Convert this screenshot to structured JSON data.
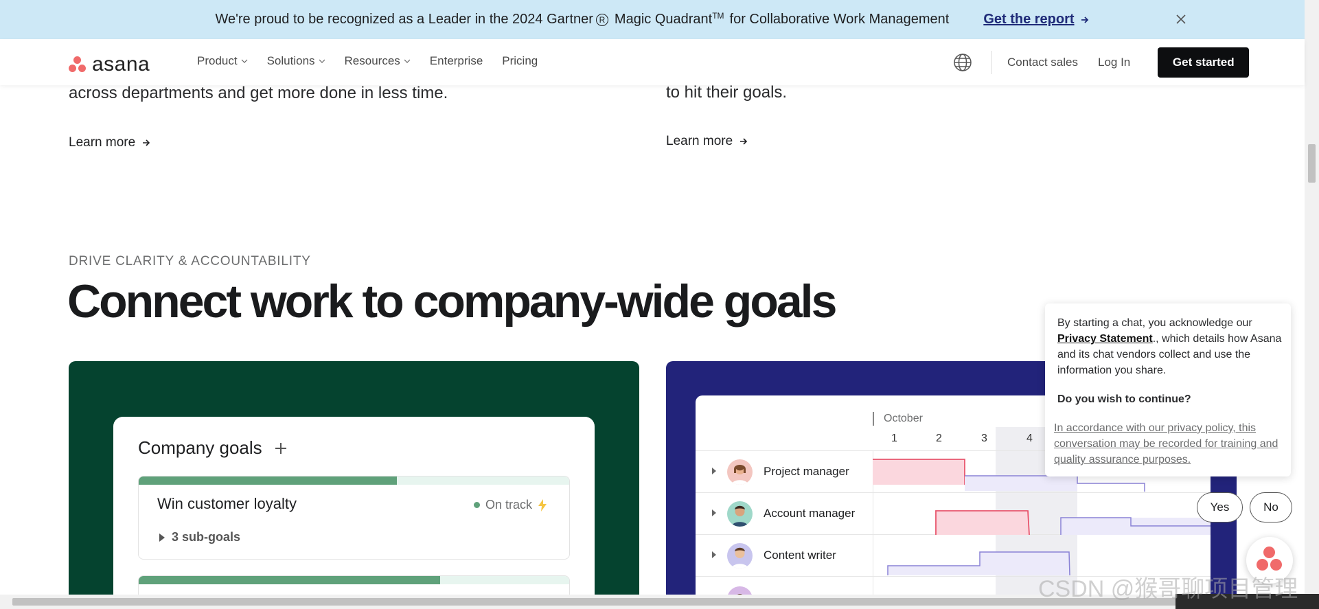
{
  "banner": {
    "message_prefix": "We're proud to be recognized as a Leader in the 2024 Gartner",
    "registered": "R",
    "message_mid": "Magic Quadrant",
    "trademark": "TM",
    "message_suffix": "for Collaborative Work Management",
    "cta": "Get the report"
  },
  "nav": {
    "brand": "asana",
    "items": [
      {
        "label": "Product",
        "has_dropdown": true
      },
      {
        "label": "Solutions",
        "has_dropdown": true
      },
      {
        "label": "Resources",
        "has_dropdown": true
      },
      {
        "label": "Enterprise",
        "has_dropdown": false
      },
      {
        "label": "Pricing",
        "has_dropdown": false
      }
    ],
    "contact": "Contact sales",
    "login": "Log In",
    "get_started": "Get started"
  },
  "content": {
    "left_text": "across departments and get more done in less time.",
    "right_text": "to hit their goals.",
    "learn_more": "Learn more",
    "eyebrow": "DRIVE CLARITY & ACCOUNTABILITY",
    "headline": "Connect work to company-wide goals"
  },
  "goals_card": {
    "title": "Company goals",
    "goal": {
      "name": "Win customer loyalty",
      "status": "On track",
      "sub_goals": "3 sub-goals",
      "progress": 0.6
    },
    "second_goal_progress": 0.7
  },
  "timeline": {
    "month": "October",
    "days": [
      "1",
      "2",
      "3",
      "4"
    ],
    "rows": [
      {
        "name": "Project manager"
      },
      {
        "name": "Account manager"
      },
      {
        "name": "Content writer"
      }
    ]
  },
  "chat_consent": {
    "intro": "By starting a chat, you acknowledge our",
    "link": "Privacy Statement",
    "rest": "., which details how Asana and its chat vendors collect and use the information you share.",
    "question": "Do you wish to continue?",
    "policy_note": "In accordance with our privacy policy, this conversation may be recorded for training and quality assurance purposes.",
    "yes": "Yes",
    "no": "No"
  },
  "watermark": "CSDN @猴哥聊项目管理",
  "colors": {
    "banner_bg": "#cde8f6",
    "brand_coral": "#f06a6a",
    "green_card": "#05432f",
    "navy_card": "#22237a",
    "goal_green": "#5fa17a",
    "timeline_pink": "#fbd7de",
    "timeline_purple": "#8a82d6"
  }
}
